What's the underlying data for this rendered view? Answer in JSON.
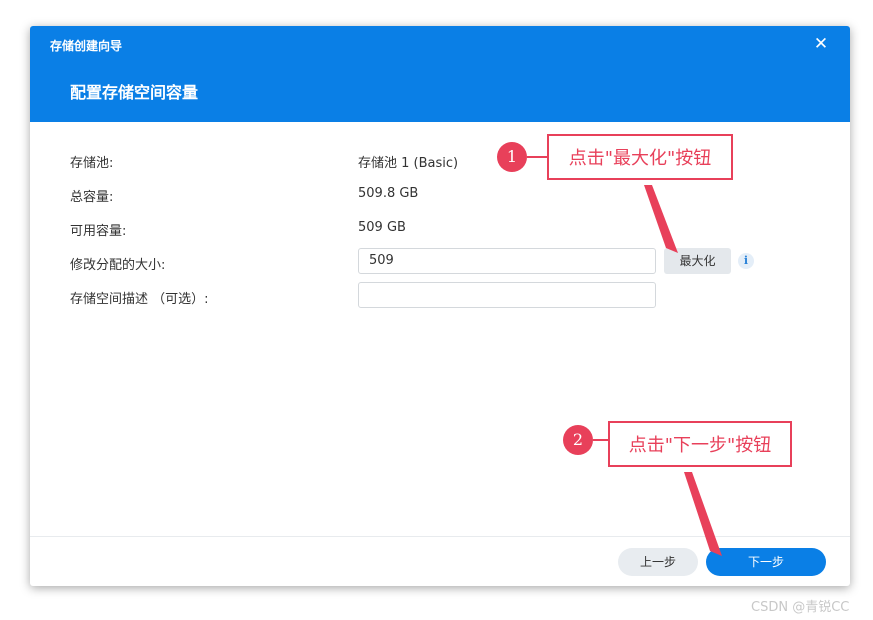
{
  "dialog": {
    "title": "存储创建向导",
    "close_icon": "close-icon",
    "step_title": "配置存储空间容量"
  },
  "fields": {
    "pool": {
      "label": "存储池:",
      "value": "存储池 1 (Basic)"
    },
    "total": {
      "label": "总容量:",
      "value": "509.8 GB"
    },
    "available": {
      "label": "可用容量:",
      "value": "509 GB"
    },
    "size": {
      "label": "修改分配的大小:",
      "value": "509"
    },
    "description": {
      "label": "存储空间描述 （可选）:",
      "value": ""
    }
  },
  "buttons": {
    "maximize": "最大化",
    "info_icon": "i",
    "prev": "上一步",
    "next": "下一步"
  },
  "annotations": {
    "step1": {
      "number": "1",
      "text": "点击\"最大化\"按钮"
    },
    "step2": {
      "number": "2",
      "text": "点击\"下一步\"按钮"
    },
    "color": "#e8405a"
  },
  "watermark": "CSDN @青锐CC",
  "colors": {
    "accent": "#0a7fe6"
  }
}
